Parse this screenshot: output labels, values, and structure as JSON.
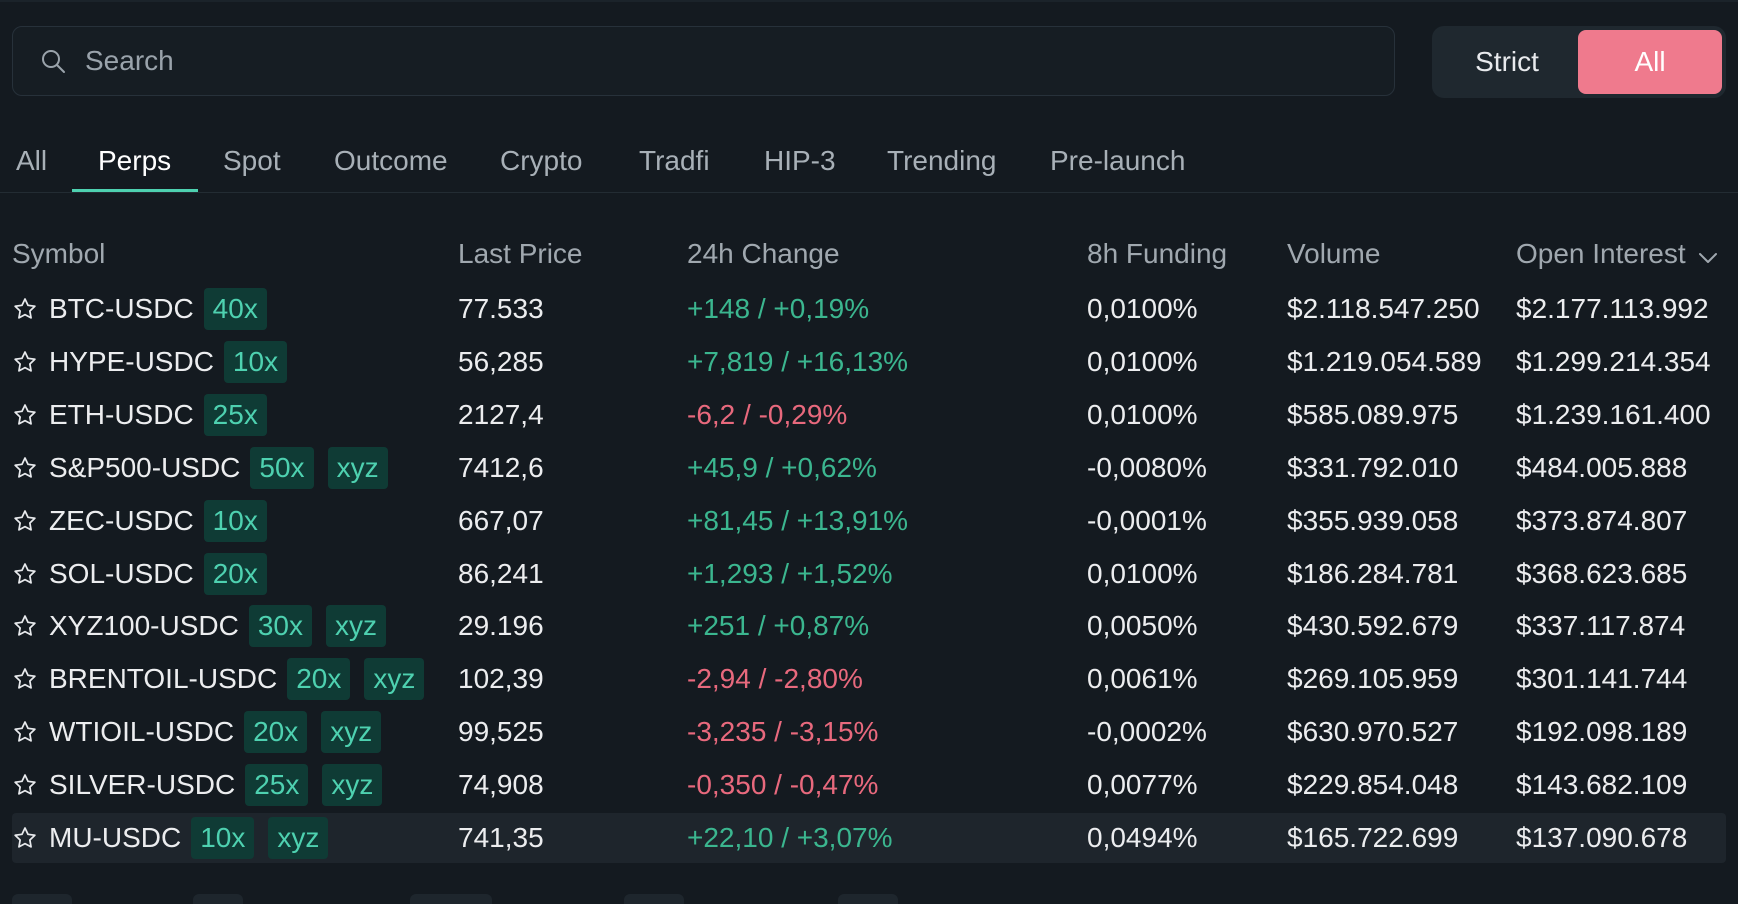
{
  "search": {
    "placeholder": "Search",
    "value": ""
  },
  "mode_toggle": {
    "options": [
      "Strict",
      "All"
    ],
    "selected": "All"
  },
  "colors": {
    "accent": "#ef7a8d",
    "teal": "#4ed1b0",
    "positive": "#3bb68f",
    "negative": "#e8697d",
    "background": "#141a20"
  },
  "tabs": [
    "All",
    "Perps",
    "Spot",
    "Outcome",
    "Crypto",
    "Tradfi",
    "HIP-3",
    "Trending",
    "Pre-launch"
  ],
  "active_tab": "Perps",
  "columns": [
    "Symbol",
    "Last Price",
    "24h Change",
    "8h Funding",
    "Volume",
    "Open Interest"
  ],
  "sort_icon": "chevron-down-icon",
  "rows": [
    {
      "symbol": "BTC-USDC",
      "leverage": "40x",
      "tag": "",
      "last_price": "77.533",
      "change": "+148 / +0,19%",
      "direction": "up",
      "funding": "0,0100%",
      "volume": "$2.118.547.250",
      "open_interest": "$2.177.113.992"
    },
    {
      "symbol": "HYPE-USDC",
      "leverage": "10x",
      "tag": "",
      "last_price": "56,285",
      "change": "+7,819 / +16,13%",
      "direction": "up",
      "funding": "0,0100%",
      "volume": "$1.219.054.589",
      "open_interest": "$1.299.214.354"
    },
    {
      "symbol": "ETH-USDC",
      "leverage": "25x",
      "tag": "",
      "last_price": "2127,4",
      "change": "-6,2 / -0,29%",
      "direction": "down",
      "funding": "0,0100%",
      "volume": "$585.089.975",
      "open_interest": "$1.239.161.400"
    },
    {
      "symbol": "S&P500-USDC",
      "leverage": "50x",
      "tag": "xyz",
      "last_price": "7412,6",
      "change": "+45,9 / +0,62%",
      "direction": "up",
      "funding": "-0,0080%",
      "volume": "$331.792.010",
      "open_interest": "$484.005.888"
    },
    {
      "symbol": "ZEC-USDC",
      "leverage": "10x",
      "tag": "",
      "last_price": "667,07",
      "change": "+81,45 / +13,91%",
      "direction": "up",
      "funding": "-0,0001%",
      "volume": "$355.939.058",
      "open_interest": "$373.874.807"
    },
    {
      "symbol": "SOL-USDC",
      "leverage": "20x",
      "tag": "",
      "last_price": "86,241",
      "change": "+1,293 / +1,52%",
      "direction": "up",
      "funding": "0,0100%",
      "volume": "$186.284.781",
      "open_interest": "$368.623.685"
    },
    {
      "symbol": "XYZ100-USDC",
      "leverage": "30x",
      "tag": "xyz",
      "last_price": "29.196",
      "change": "+251 / +0,87%",
      "direction": "up",
      "funding": "0,0050%",
      "volume": "$430.592.679",
      "open_interest": "$337.117.874"
    },
    {
      "symbol": "BRENTOIL-USDC",
      "leverage": "20x",
      "tag": "xyz",
      "last_price": "102,39",
      "change": "-2,94 / -2,80%",
      "direction": "down",
      "funding": "0,0061%",
      "volume": "$269.105.959",
      "open_interest": "$301.141.744"
    },
    {
      "symbol": "WTIOIL-USDC",
      "leverage": "20x",
      "tag": "xyz",
      "last_price": "99,525",
      "change": "-3,235 / -3,15%",
      "direction": "down",
      "funding": "-0,0002%",
      "volume": "$630.970.527",
      "open_interest": "$192.098.189"
    },
    {
      "symbol": "SILVER-USDC",
      "leverage": "25x",
      "tag": "xyz",
      "last_price": "74,908",
      "change": "-0,350 / -0,47%",
      "direction": "down",
      "funding": "0,0077%",
      "volume": "$229.854.048",
      "open_interest": "$143.682.109"
    },
    {
      "symbol": "MU-USDC",
      "leverage": "10x",
      "tag": "xyz",
      "last_price": "741,35",
      "change": "+22,10 / +3,07%",
      "direction": "up",
      "funding": "0,0494%",
      "volume": "$165.722.699",
      "open_interest": "$137.090.678"
    }
  ],
  "hovered_row": "MU-USDC"
}
